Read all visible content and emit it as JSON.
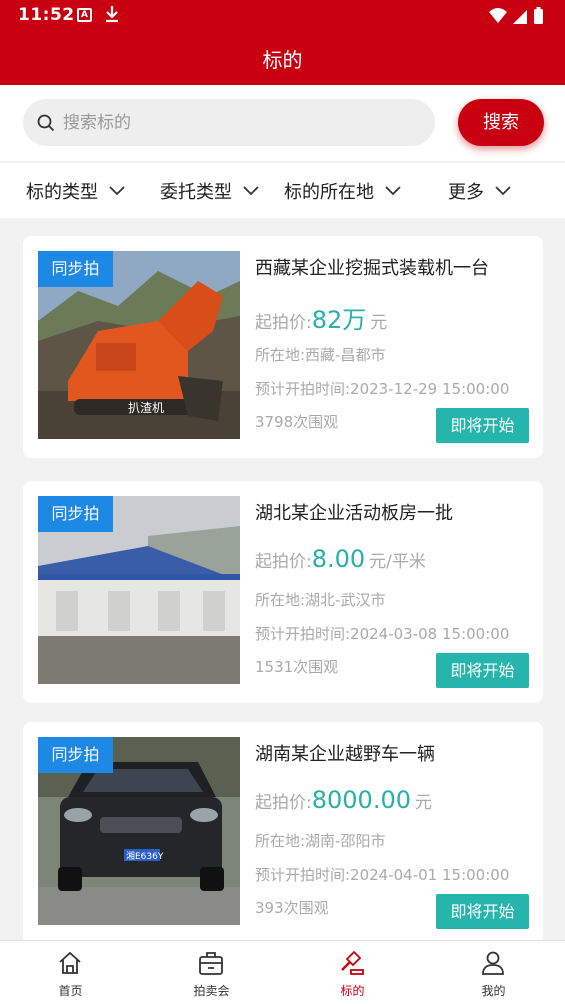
{
  "status": {
    "time": "11:52"
  },
  "header": {
    "title": "标的"
  },
  "search": {
    "placeholder": "搜索标的",
    "button": "搜索"
  },
  "filters": [
    {
      "label": "标的类型"
    },
    {
      "label": "委托类型"
    },
    {
      "label": "标的所在地"
    },
    {
      "label": "更多"
    }
  ],
  "listings": [
    {
      "badge": "同步拍",
      "title": "西藏某企业挖掘式装载机一台",
      "price_label": "起拍价:",
      "price": "82万",
      "unit": "元",
      "location": "所在地:西藏-昌都市",
      "time": "预计开拍时间:2023-12-29 15:00:00",
      "views": "3798次围观",
      "action": "即将开始",
      "image_text": "扒渣机"
    },
    {
      "badge": "同步拍",
      "title": "湖北某企业活动板房一批",
      "price_label": "起拍价:",
      "price": "8.00",
      "unit": "元/平米",
      "location": "所在地:湖北-武汉市",
      "time": "预计开拍时间:2024-03-08 15:00:00",
      "views": "1531次围观",
      "action": "即将开始"
    },
    {
      "badge": "同步拍",
      "title": "湖南某企业越野车一辆",
      "price_label": "起拍价:",
      "price": "8000.00",
      "unit": "元",
      "location": "所在地:湖南-邵阳市",
      "time": "预计开拍时间:2024-04-01 15:00:00",
      "views": "393次围观",
      "action": "即将开始",
      "image_text": "湘E636Y"
    }
  ],
  "tabs": [
    {
      "label": "首页",
      "icon": "home-icon"
    },
    {
      "label": "拍卖会",
      "icon": "briefcase-icon"
    },
    {
      "label": "标的",
      "icon": "gavel-icon",
      "active": true
    },
    {
      "label": "我的",
      "icon": "user-icon"
    }
  ],
  "colors": {
    "primary": "#c8000f",
    "accent": "#26b5ad",
    "badge": "#1e88e5"
  }
}
